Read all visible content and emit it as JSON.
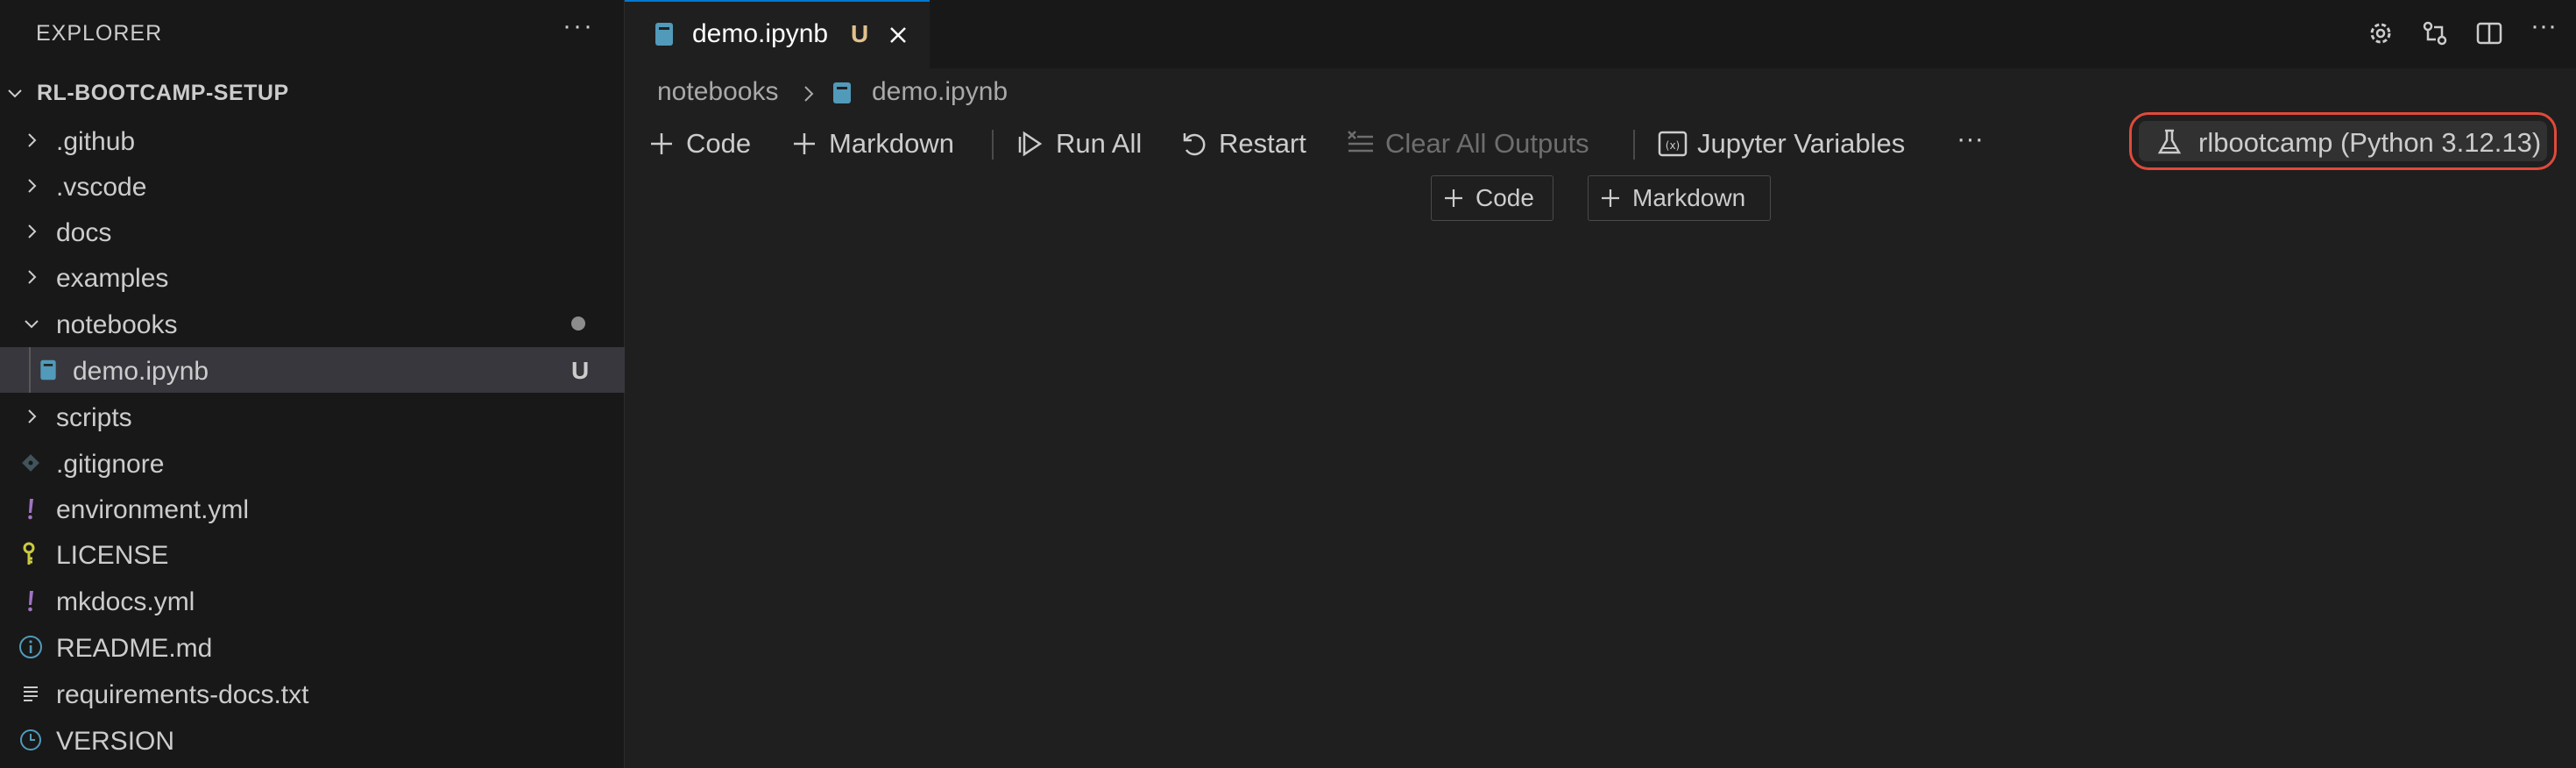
{
  "explorer": {
    "title": "EXPLORER",
    "more_icon": "ellipsis-icon",
    "project": "RL-BOOTCAMP-SETUP",
    "items": [
      {
        "label": ".github",
        "kind": "folder"
      },
      {
        "label": ".vscode",
        "kind": "folder"
      },
      {
        "label": "docs",
        "kind": "folder"
      },
      {
        "label": "examples",
        "kind": "folder"
      },
      {
        "label": "notebooks",
        "kind": "folder-open"
      },
      {
        "label": "demo.ipynb",
        "kind": "notebook",
        "badge": "U"
      },
      {
        "label": "scripts",
        "kind": "folder"
      },
      {
        "label": ".gitignore",
        "kind": "git"
      },
      {
        "label": "environment.yml",
        "kind": "yaml"
      },
      {
        "label": "LICENSE",
        "kind": "license"
      },
      {
        "label": "mkdocs.yml",
        "kind": "yaml"
      },
      {
        "label": "README.md",
        "kind": "info"
      },
      {
        "label": "requirements-docs.txt",
        "kind": "text"
      },
      {
        "label": "VERSION",
        "kind": "clock"
      }
    ]
  },
  "tab": {
    "label": "demo.ipynb",
    "status": "U"
  },
  "breadcrumb": {
    "folder": "notebooks",
    "file": "demo.ipynb"
  },
  "toolbar": {
    "code": "Code",
    "markdown": "Markdown",
    "run_all": "Run All",
    "restart": "Restart",
    "clear_all_outputs": "Clear All Outputs",
    "jupyter_variables": "Jupyter Variables",
    "more": "···"
  },
  "kernel": {
    "label": "rlbootcamp (Python 3.12.13)"
  },
  "insert": {
    "code": "Code",
    "markdown": "Markdown"
  },
  "colors": {
    "accent": "#0078d4",
    "highlight": "#e04a3a",
    "untracked": "#e2c08d"
  }
}
